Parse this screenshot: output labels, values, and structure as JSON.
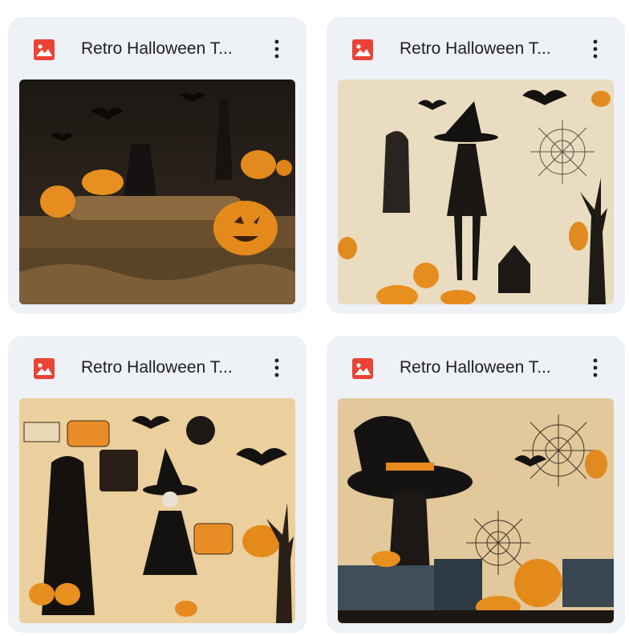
{
  "files": [
    {
      "title": "Retro Halloween T...",
      "type_icon": "image-file-icon",
      "menu_icon": "more-vert-icon"
    },
    {
      "title": "Retro Halloween T...",
      "type_icon": "image-file-icon",
      "menu_icon": "more-vert-icon"
    },
    {
      "title": "Retro Halloween T...",
      "type_icon": "image-file-icon",
      "menu_icon": "more-vert-icon"
    },
    {
      "title": "Retro Halloween T...",
      "type_icon": "image-file-icon",
      "menu_icon": "more-vert-icon"
    }
  ],
  "colors": {
    "card_background": "#eef1f6",
    "image_icon_red": "#ea4335",
    "title_text": "#1f1f1f"
  }
}
